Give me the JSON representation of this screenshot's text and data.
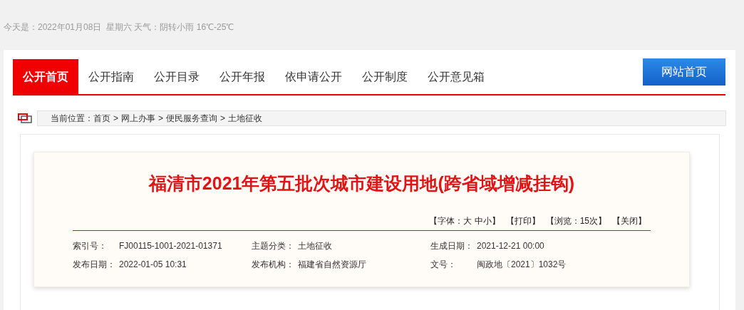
{
  "top_bar": {
    "date_text": "今天是：2022年01月08日  星期六 天气：阴转小雨 16℃-25℃"
  },
  "nav": {
    "tabs": [
      {
        "label": "公开首页",
        "selected": true
      },
      {
        "label": "公开指南",
        "selected": false
      },
      {
        "label": "公开目录",
        "selected": false
      },
      {
        "label": "公开年报",
        "selected": false
      },
      {
        "label": "依申请公开",
        "selected": false
      },
      {
        "label": "公开制度",
        "selected": false
      },
      {
        "label": "公开意见箱",
        "selected": false
      }
    ],
    "home_button": "网站首页"
  },
  "breadcrumb": {
    "label": "当前位置：",
    "items": [
      "首页",
      "网上办事",
      "便民服务查询",
      "土地征收"
    ],
    "separator": ">"
  },
  "article": {
    "title": "福清市2021年第五批次城市建设用地(跨省域增减挂钩)",
    "tools": [
      "【字体：大 中小】",
      "【打印】",
      "【浏览：15次】",
      "【关闭】"
    ],
    "meta": [
      [
        {
          "label": "索引号：",
          "value": "FJ00115-1001-2021-01371"
        },
        {
          "label": "主题分类：",
          "value": "土地征收"
        },
        {
          "label": "生成日期：",
          "value": "2021-12-21 00:00"
        }
      ],
      [
        {
          "label": "发布日期：",
          "value": "2022-01-05 10:31"
        },
        {
          "label": "发布机构：",
          "value": "福建省自然资源厅"
        },
        {
          "label": "文号：",
          "value": "闽政地〔2021〕1032号"
        }
      ]
    ]
  }
}
